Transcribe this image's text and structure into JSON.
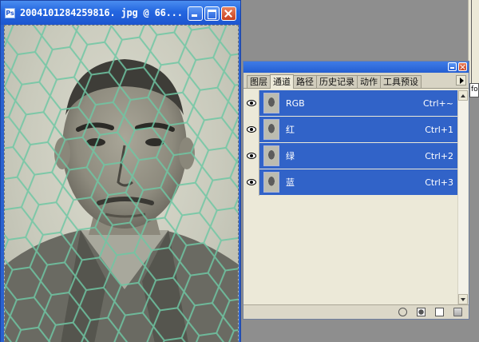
{
  "document_window": {
    "title": "2004101284259816. jpg @ 66...",
    "app_icon": "photoshop-doc-icon"
  },
  "channels_panel": {
    "tabs": [
      {
        "label": "图层",
        "active": false
      },
      {
        "label": "通道",
        "active": true
      },
      {
        "label": "路径",
        "active": false
      },
      {
        "label": "历史记录",
        "active": false
      },
      {
        "label": "动作",
        "active": false
      },
      {
        "label": "工具预设",
        "active": false
      }
    ],
    "channels": [
      {
        "name": "RGB",
        "shortcut": "Ctrl+~"
      },
      {
        "name": "红",
        "shortcut": "Ctrl+1"
      },
      {
        "name": "绿",
        "shortcut": "Ctrl+2"
      },
      {
        "name": "蓝",
        "shortcut": "Ctrl+3"
      }
    ],
    "selection_color": "#3163c8"
  },
  "edge_fragment": "fo"
}
